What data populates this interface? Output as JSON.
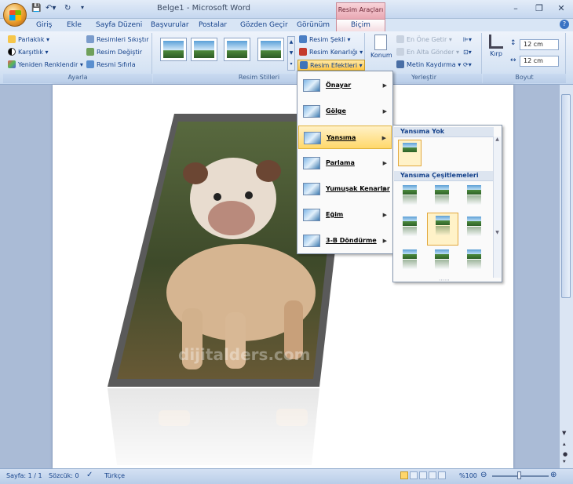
{
  "window": {
    "title": "Belge1 - Microsoft Word",
    "context_tab_group": "Resim Araçları"
  },
  "tabs": [
    "Giriş",
    "Ekle",
    "Sayfa Düzeni",
    "Başvurular",
    "Postalar",
    "Gözden Geçir",
    "Görünüm",
    "Biçim"
  ],
  "ribbon": {
    "ayarla": {
      "label": "Ayarla",
      "parlaklik": "Parlaklık",
      "karsitlik": "Karşıtlık",
      "yeniden_renk": "Yeniden Renklendir",
      "sikistir": "Resimleri Sıkıştır",
      "degistir": "Resim Değiştir",
      "sifirla": "Resmi Sıfırla"
    },
    "resim_stilleri": {
      "label": "Resim Stilleri",
      "sekli": "Resim Şekli",
      "kenarligi": "Resim Kenarlığı",
      "efektleri": "Resim Efektleri"
    },
    "yerlestir": {
      "label": "Yerleştir",
      "konum": "Konum",
      "en_one": "En Öne Getir",
      "en_alta": "En Alta Gönder",
      "metin_kaydirma": "Metin Kaydırma"
    },
    "boyut": {
      "label": "Boyut",
      "kirp": "Kırp",
      "height": "12 cm",
      "width": "12 cm"
    }
  },
  "effects_menu": {
    "items": [
      {
        "label": "Önayar"
      },
      {
        "label": "Gölge"
      },
      {
        "label": "Yansıma"
      },
      {
        "label": "Parlama"
      },
      {
        "label": "Yumuşak Kenarlar"
      },
      {
        "label": "Eğim"
      },
      {
        "label": "3-B Döndürme"
      }
    ],
    "active_index": 2
  },
  "reflection_submenu": {
    "none_header": "Yansıma Yok",
    "variants_header": "Yansıma Çeşitlemeleri",
    "selected_variant": 4
  },
  "document": {
    "watermark": "dijitalders.com"
  },
  "status": {
    "page": "Sayfa: 1 / 1",
    "words": "Sözcük: 0",
    "language": "Türkçe",
    "zoom": "%100"
  }
}
